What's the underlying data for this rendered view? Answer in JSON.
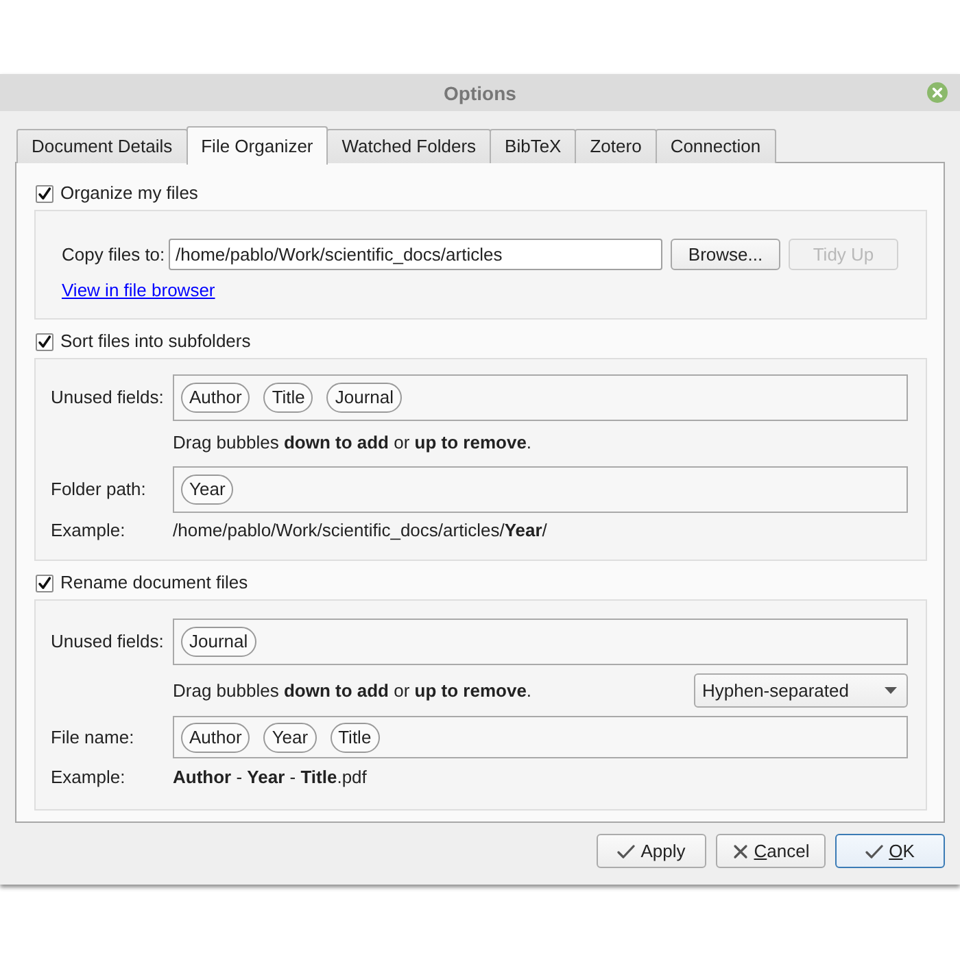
{
  "window": {
    "title": "Options"
  },
  "tabs": [
    {
      "label": "Document Details",
      "selected": false
    },
    {
      "label": "File Organizer",
      "selected": true
    },
    {
      "label": "Watched Folders",
      "selected": false
    },
    {
      "label": "BibTeX",
      "selected": false
    },
    {
      "label": "Zotero",
      "selected": false
    },
    {
      "label": "Connection",
      "selected": false
    }
  ],
  "organize": {
    "label": "Organize my files",
    "checked": true,
    "copy_label": "Copy files to:",
    "path": "/home/pablo/Work/scientific_docs/articles",
    "buttons": [
      {
        "label": "Browse...",
        "disabled": false
      },
      {
        "label": "Tidy Up",
        "disabled": true
      }
    ],
    "link": "View in file browser"
  },
  "subfolders": {
    "label": "Sort files into subfolders",
    "checked": true,
    "unused_label": "Unused fields:",
    "unused": [
      "Author",
      "Title",
      "Journal"
    ],
    "hint": "Drag bubbles **down to add** or **up to remove**.",
    "path_label": "Folder path:",
    "path": [
      "Year"
    ],
    "example_label": "Example:",
    "example": "/home/pablo/Work/scientific_docs/articles/**Year**/"
  },
  "rename": {
    "label": "Rename document files",
    "checked": true,
    "unused_label": "Unused fields:",
    "unused": [
      "Journal"
    ],
    "hint": "Drag bubbles **down to add** or **up to remove**.",
    "separator": "Hyphen-separated",
    "name_label": "File name:",
    "name": [
      "Author",
      "Year",
      "Title"
    ],
    "example_label": "Example:",
    "example": "**Author** - **Year** - **Title**.pdf"
  },
  "buttons": [
    {
      "label": "Apply",
      "kind": "confirm",
      "default": false,
      "mnemonic": false
    },
    {
      "label": "Cancel",
      "kind": "cancel",
      "default": false,
      "mnemonic": true
    },
    {
      "label": "OK",
      "kind": "confirm",
      "default": true,
      "mnemonic": true
    }
  ]
}
